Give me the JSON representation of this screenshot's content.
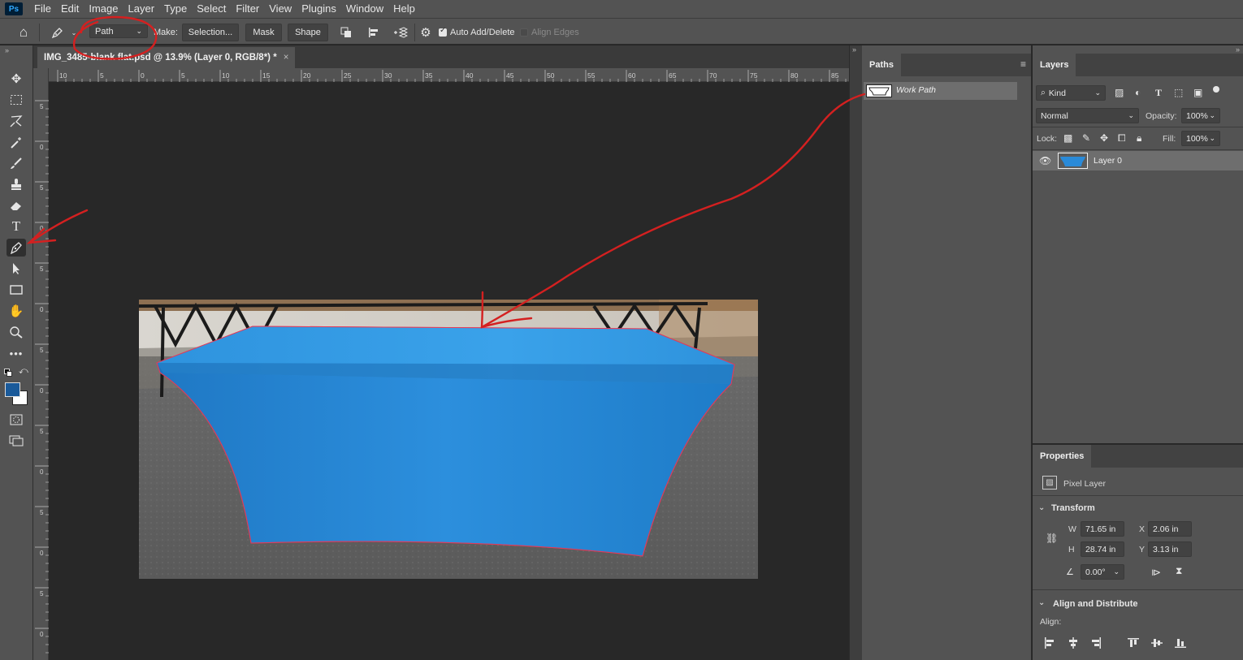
{
  "menu": {
    "logo": "Ps",
    "items": [
      "File",
      "Edit",
      "Image",
      "Layer",
      "Type",
      "Select",
      "Filter",
      "View",
      "Plugins",
      "Window",
      "Help"
    ]
  },
  "options": {
    "mode_value": "Path",
    "make_label": "Make:",
    "selection_label": "Selection...",
    "mask_label": "Mask",
    "shape_label": "Shape",
    "auto_add_delete_label": "Auto Add/Delete",
    "auto_add_delete_checked": true,
    "align_edges_label": "Align Edges",
    "align_edges_checked": false
  },
  "document": {
    "tab_title": "IMG_3485-blank flat.psd @ 13.9% (Layer 0, RGB/8*) *",
    "close_glyph": "×"
  },
  "rulers": {
    "h_labels": [
      "10",
      "5",
      "0",
      "5",
      "10",
      "15",
      "20",
      "25",
      "30",
      "35",
      "40",
      "45",
      "50",
      "55",
      "60",
      "65",
      "70",
      "75",
      "80",
      "85"
    ],
    "v_labels": [
      "5",
      "0",
      "5",
      "0",
      "5",
      "0",
      "5",
      "0",
      "5",
      "0",
      "5",
      "0",
      "5",
      "0"
    ]
  },
  "paths_panel": {
    "tab": "Paths",
    "work_path": "Work Path"
  },
  "layers_panel": {
    "tab": "Layers",
    "kind_label": "Kind",
    "blend_mode": "Normal",
    "opacity_label": "Opacity:",
    "opacity_value": "100%",
    "lock_label": "Lock:",
    "fill_label": "Fill:",
    "fill_value": "100%",
    "layers": [
      {
        "name": "Layer 0",
        "visible": true
      }
    ]
  },
  "properties_panel": {
    "tab": "Properties",
    "type_label": "Pixel Layer",
    "transform_title": "Transform",
    "w_label": "W",
    "w_value": "71.65 in",
    "h_label": "H",
    "h_value": "28.74 in",
    "x_label": "X",
    "x_value": "2.06 in",
    "y_label": "Y",
    "y_value": "3.13 in",
    "angle_value": "0.00°",
    "align_title": "Align and Distribute",
    "align_label": "Align:"
  },
  "colors": {
    "foreground": "#1a5a9a",
    "background": "#ffffff",
    "annotation": "#d42020",
    "tablecloth": "#2a8ad8"
  }
}
